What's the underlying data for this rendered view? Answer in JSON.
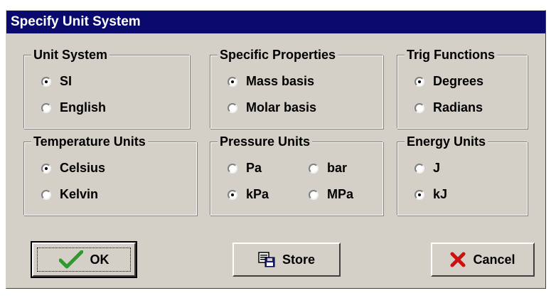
{
  "window": {
    "title": "Specify Unit System"
  },
  "groups": {
    "unit_system": {
      "title": "Unit System",
      "options": [
        {
          "label": "SI",
          "checked": true
        },
        {
          "label": "English",
          "checked": false
        }
      ]
    },
    "specific_properties": {
      "title": "Specific Properties",
      "options": [
        {
          "label": "Mass basis",
          "checked": true
        },
        {
          "label": "Molar basis",
          "checked": false
        }
      ]
    },
    "trig_functions": {
      "title": "Trig Functions",
      "options": [
        {
          "label": "Degrees",
          "checked": true
        },
        {
          "label": "Radians",
          "checked": false
        }
      ]
    },
    "temperature_units": {
      "title": "Temperature Units",
      "options": [
        {
          "label": "Celsius",
          "checked": true
        },
        {
          "label": "Kelvin",
          "checked": false
        }
      ]
    },
    "pressure_units": {
      "title": "Pressure Units",
      "options": [
        {
          "label": "Pa",
          "checked": false
        },
        {
          "label": "bar",
          "checked": false
        },
        {
          "label": "kPa",
          "checked": true
        },
        {
          "label": "MPa",
          "checked": false
        }
      ]
    },
    "energy_units": {
      "title": "Energy Units",
      "options": [
        {
          "label": "J",
          "checked": false
        },
        {
          "label": "kJ",
          "checked": true
        }
      ]
    }
  },
  "buttons": {
    "ok": {
      "label": "OK",
      "icon": "checkmark-icon"
    },
    "store": {
      "label": "Store",
      "icon": "store-icon"
    },
    "cancel": {
      "label": "Cancel",
      "icon": "x-icon"
    }
  },
  "colors": {
    "titlebar": "#0a0a6e",
    "face": "#d4d0c8",
    "ok_check": "#2e9a2e",
    "cancel_x": "#cc1111"
  }
}
